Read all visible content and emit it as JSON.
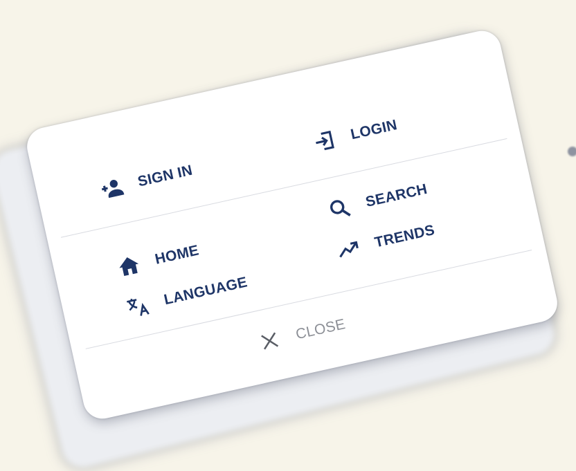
{
  "menu": {
    "items": {
      "sign_in": {
        "label": "SIGN IN",
        "icon": "add-person-icon"
      },
      "login": {
        "label": "LOGIN",
        "icon": "login-icon"
      },
      "home": {
        "label": "HOME",
        "icon": "home-icon"
      },
      "search": {
        "label": "SEARCH",
        "icon": "search-icon"
      },
      "language": {
        "label": "LANGUAGE",
        "icon": "translate-icon"
      },
      "trends": {
        "label": "TRENDS",
        "icon": "trending-up-icon"
      },
      "close": {
        "label": "CLOSE",
        "icon": "close-icon"
      }
    },
    "colors": {
      "primary": "#1e3567",
      "muted": "#8c8f96",
      "surface": "#ffffff",
      "background": "#f7f4e9"
    }
  }
}
